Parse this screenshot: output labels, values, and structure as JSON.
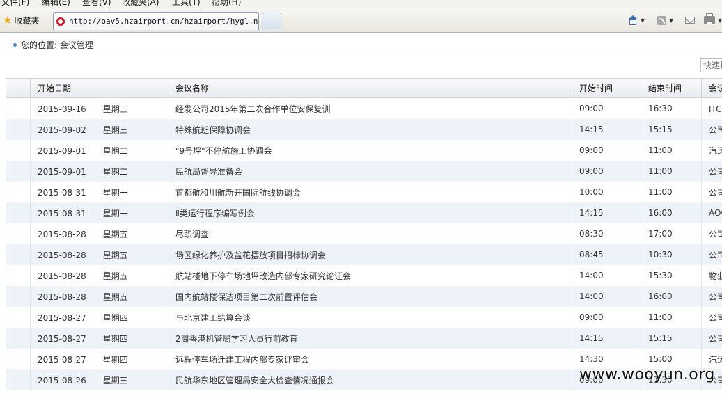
{
  "browser": {
    "menu": [
      "文件(F)",
      "编辑(E)",
      "查看(V)",
      "收藏夹(A)",
      "工具(T)",
      "帮助(H)"
    ],
    "favorites_label": "收藏夹",
    "tab_title": "http://oav5.hzairport.cn/hzairport/hygl.n..."
  },
  "page": {
    "breadcrumb": "您的位置: 会议管理",
    "quick_search_placeholder": "快速搜索"
  },
  "table": {
    "columns": [
      "开始日期",
      "会议名称",
      "开始时间",
      "结束时间",
      "会议"
    ],
    "rows": [
      {
        "date": "2015-09-16",
        "weekday": "星期三",
        "name": "经发公司2015年第二次合作单位安保复训",
        "start": "09:00",
        "end": "16:30",
        "room": "ITC会"
      },
      {
        "date": "2015-09-02",
        "weekday": "星期三",
        "name": "特殊航班保障协调会",
        "start": "14:15",
        "end": "15:15",
        "room": "公司"
      },
      {
        "date": "2015-09-01",
        "weekday": "星期二",
        "name": "\"9号坪\"不停航施工协调会",
        "start": "09:00",
        "end": "11:00",
        "room": "汽运"
      },
      {
        "date": "2015-09-01",
        "weekday": "星期二",
        "name": "民航局督导准备会",
        "start": "09:00",
        "end": "11:00",
        "room": "公司"
      },
      {
        "date": "2015-08-31",
        "weekday": "星期一",
        "name": "首都航和川航新开国际航线协调会",
        "start": "10:00",
        "end": "11:00",
        "room": "公司"
      },
      {
        "date": "2015-08-31",
        "weekday": "星期一",
        "name": "Ⅱ类运行程序编写例会",
        "start": "14:15",
        "end": "16:00",
        "room": "AOC"
      },
      {
        "date": "2015-08-28",
        "weekday": "星期五",
        "name": "尽职调查",
        "start": "08:30",
        "end": "17:00",
        "room": "公司"
      },
      {
        "date": "2015-08-28",
        "weekday": "星期五",
        "name": "场区绿化养护及盆花摆放项目招标协调会",
        "start": "08:45",
        "end": "10:30",
        "room": "公司"
      },
      {
        "date": "2015-08-28",
        "weekday": "星期五",
        "name": "航站楼地下停车场地坪改造内部专家研究论证会",
        "start": "14:00",
        "end": "15:30",
        "room": "物业"
      },
      {
        "date": "2015-08-28",
        "weekday": "星期五",
        "name": "国内航站楼保洁项目第二次前置评估会",
        "start": "14:00",
        "end": "16:00",
        "room": "公司"
      },
      {
        "date": "2015-08-27",
        "weekday": "星期四",
        "name": "与北京建工结算会谈",
        "start": "09:00",
        "end": "11:00",
        "room": "公司"
      },
      {
        "date": "2015-08-27",
        "weekday": "星期四",
        "name": "2周香港机管局学习人员行前教育",
        "start": "14:15",
        "end": "15:15",
        "room": "公司"
      },
      {
        "date": "2015-08-27",
        "weekday": "星期四",
        "name": "远程停车场迁建工程内部专家评审会",
        "start": "14:30",
        "end": "15:00",
        "room": "汽运"
      },
      {
        "date": "2015-08-26",
        "weekday": "星期三",
        "name": "民航华东地区管理局安全大检查情况通报会",
        "start": "09:00",
        "end": "11:30",
        "room": "公司"
      }
    ]
  },
  "watermark": "www.wooyun.org"
}
